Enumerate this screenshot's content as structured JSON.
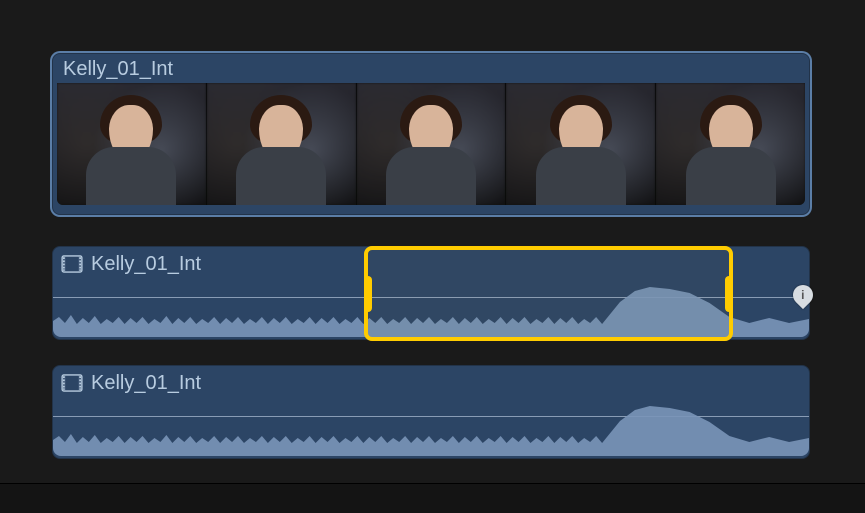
{
  "clips": [
    {
      "name": "Kelly_01_Int",
      "kind": "video-filmstrip",
      "selected": true,
      "frame_count": 5
    },
    {
      "name": "Kelly_01_Int",
      "kind": "audio-listing",
      "has_range_selection": true
    },
    {
      "name": "Kelly_01_Int",
      "kind": "audio-listing",
      "has_range_selection": false
    }
  ],
  "range_selection": {
    "clip_index": 1,
    "start_fraction": 0.41,
    "end_fraction": 0.9
  },
  "marker": {
    "clip_index": 1,
    "glyph": "i"
  },
  "colors": {
    "selection": "#ffcc00",
    "clip_background": "#2c4565",
    "text": "#b8cce0",
    "waveform": "#7a95b8"
  }
}
